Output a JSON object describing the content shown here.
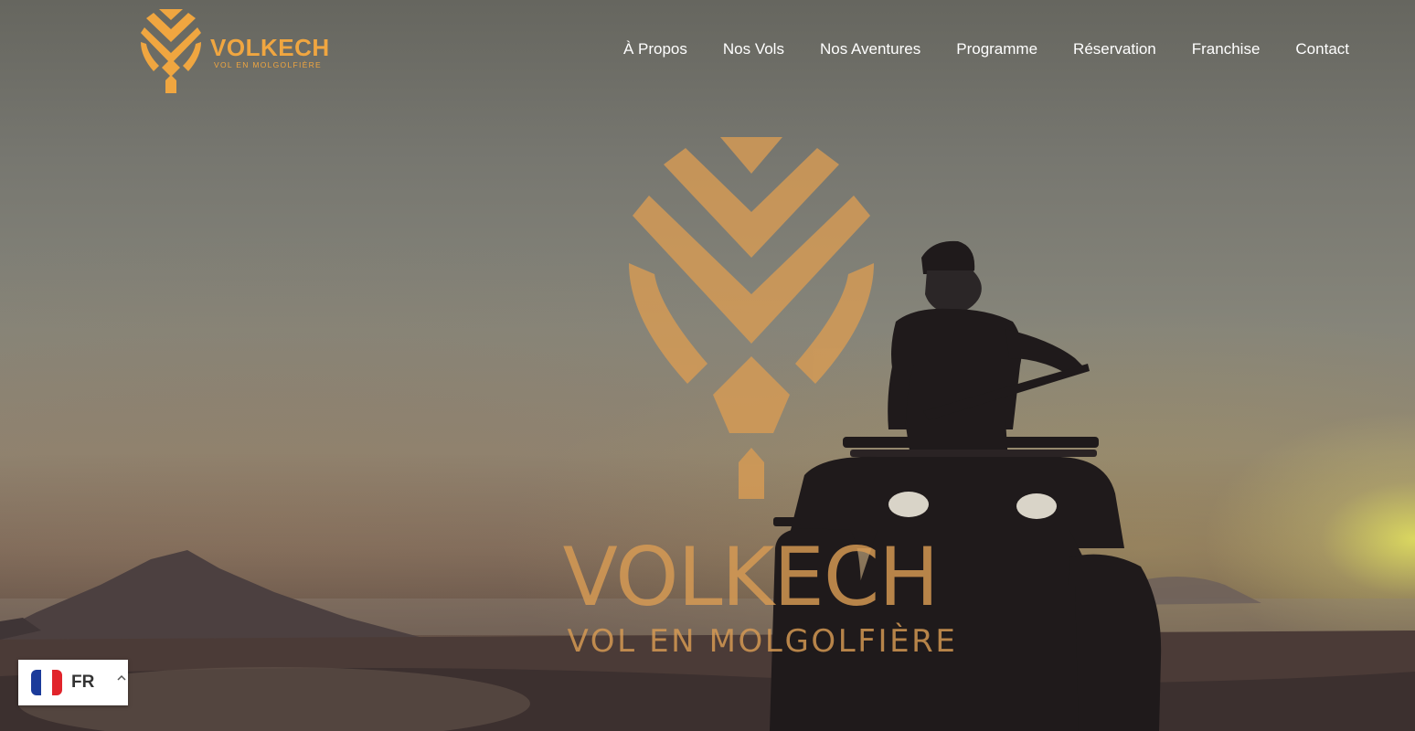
{
  "brand": {
    "name": "VOLKECH",
    "tagline": "VOL EN MOLGOLFIÈRE",
    "logo_icon": "balloon-logo-icon",
    "color": "#f0a640"
  },
  "nav": {
    "items": [
      {
        "label": "À Propos"
      },
      {
        "label": "Nos Vols"
      },
      {
        "label": "Nos Aventures"
      },
      {
        "label": "Programme"
      },
      {
        "label": "Réservation"
      },
      {
        "label": "Franchise"
      },
      {
        "label": "Contact"
      }
    ]
  },
  "hero": {
    "title": "VOLKECH",
    "tagline": "VOL EN MOLGOLFIÈRE",
    "watermark_color": "#d99c54",
    "image_description_icon": "quad-bike-rider-image"
  },
  "language": {
    "code": "FR",
    "flag_icon": "france-flag-icon",
    "flag_colors": [
      "#1b3b9a",
      "#ffffff",
      "#e1242b"
    ],
    "chevron_icon": "chevron-up-icon"
  }
}
